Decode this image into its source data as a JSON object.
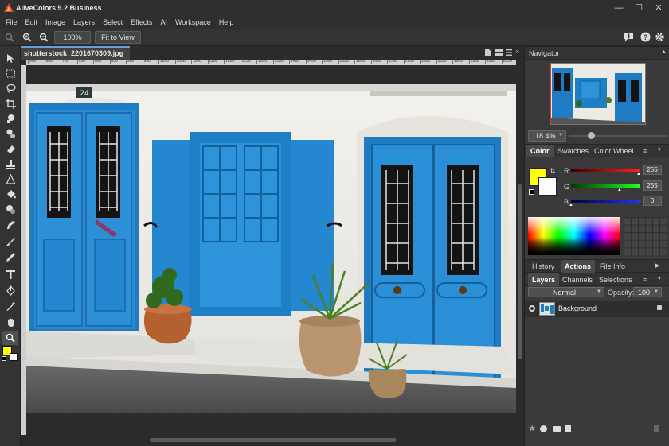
{
  "app": {
    "title": "AliveColors 9.2 Business"
  },
  "menu": [
    "File",
    "Edit",
    "Image",
    "Layers",
    "Select",
    "Effects",
    "AI",
    "Workspace",
    "Help"
  ],
  "options": {
    "zoom_value": "100%",
    "fit_label": "Fit to View"
  },
  "document": {
    "tab_label": "shutterstock_2201670309.jpg",
    "close_glyph": "×",
    "ruler_ticks": [
      "600",
      "650",
      "700",
      "750",
      "800",
      "850",
      "900",
      "950",
      "1000",
      "1050",
      "1100",
      "1150",
      "1200",
      "1250",
      "1300",
      "1350",
      "1400",
      "1450",
      "1500",
      "1550",
      "1600",
      "1650",
      "1700",
      "1750",
      "1800",
      "1850",
      "1900",
      "1950",
      "2000",
      "2050"
    ],
    "house_number": "24"
  },
  "navigator": {
    "title": "Navigator",
    "zoom": "18.4%"
  },
  "color_panel": {
    "tabs": [
      "Color",
      "Swatches",
      "Color Wheel"
    ],
    "r_label": "R",
    "g_label": "G",
    "b_label": "B",
    "r_value": "255",
    "g_value": "255",
    "b_value": "0",
    "foreground": "#ffff00",
    "background": "#ffffff"
  },
  "history_tabs": [
    "History",
    "Actions",
    "File Info"
  ],
  "layers_panel": {
    "tabs": [
      "Layers",
      "Channels",
      "Selections"
    ],
    "blend_mode": "Normal",
    "opacity_label": "Opacity:",
    "opacity_value": "100",
    "layer_name": "Background"
  },
  "colors": {
    "accent": "#6a9fd4",
    "door_blue": "#1e7fc6",
    "wall": "#ecebe7"
  }
}
